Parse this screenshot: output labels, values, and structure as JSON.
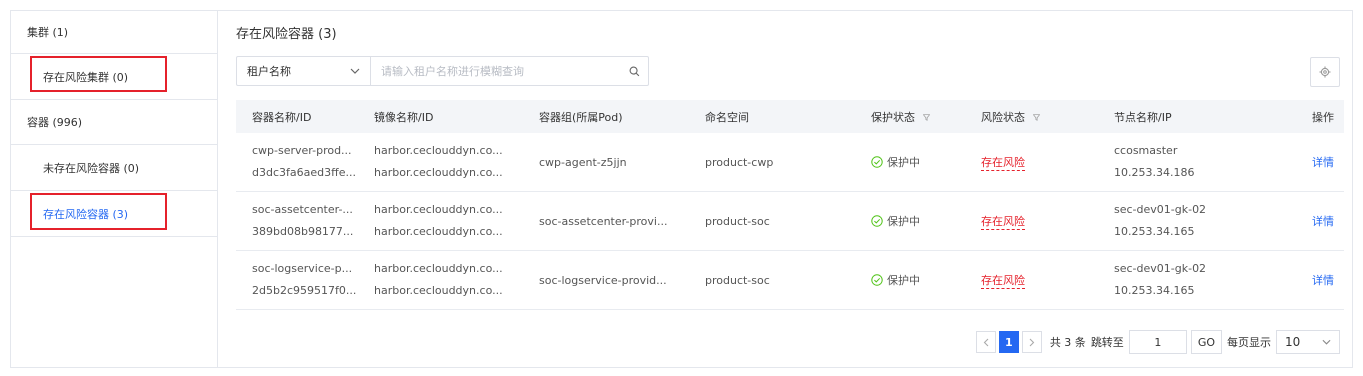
{
  "sidebar": {
    "items": [
      {
        "label": "集群 (1)"
      },
      {
        "label": "存在风险集群 (0)"
      },
      {
        "label": "容器 (996)"
      },
      {
        "label": "未存在风险容器 (0)"
      },
      {
        "label": "存在风险容器 (3)"
      }
    ]
  },
  "main": {
    "title": "存在风险容器 (3)",
    "search": {
      "select_value": "租户名称",
      "placeholder": "请输入租户名称进行模糊查询"
    }
  },
  "table": {
    "headers": [
      "容器名称/ID",
      "镜像名称/ID",
      "容器组(所属Pod)",
      "命名空间",
      "保护状态",
      "风险状态",
      "节点名称/IP",
      "操作"
    ],
    "rows": [
      {
        "name": "cwp-server-prod...",
        "id": "d3dc3fa6aed3ffe...",
        "image_name": "harbor.ceclouddyn.co...",
        "image_id": "harbor.ceclouddyn.co...",
        "pod": "cwp-agent-z5jjn",
        "namespace": "product-cwp",
        "protect": "保护中",
        "risk": "存在风险",
        "node": "ccosmaster",
        "ip": "10.253.34.186",
        "action": "详情"
      },
      {
        "name": "soc-assetcenter-...",
        "id": "389bd08b98177...",
        "image_name": "harbor.ceclouddyn.co...",
        "image_id": "harbor.ceclouddyn.co...",
        "pod": "soc-assetcenter-provi...",
        "namespace": "product-soc",
        "protect": "保护中",
        "risk": "存在风险",
        "node": "sec-dev01-gk-02",
        "ip": "10.253.34.165",
        "action": "详情"
      },
      {
        "name": "soc-logservice-p...",
        "id": "2d5b2c959517f0...",
        "image_name": "harbor.ceclouddyn.co...",
        "image_id": "harbor.ceclouddyn.co...",
        "pod": "soc-logservice-provid...",
        "namespace": "product-soc",
        "protect": "保护中",
        "risk": "存在风险",
        "node": "sec-dev01-gk-02",
        "ip": "10.253.34.165",
        "action": "详情"
      }
    ]
  },
  "pagination": {
    "current_page": "1",
    "total_text": "共 3 条",
    "jump_label": "跳转至",
    "jump_value": "1",
    "go_label": "GO",
    "page_size_label": "每页显示",
    "page_size": "10"
  },
  "colors": {
    "accent": "#2468f2",
    "risk": "#e5212b",
    "highlight_box": "#e5212b",
    "ok": "#52c41a"
  },
  "icons": [
    "chevron-down-icon",
    "search-icon",
    "gear-icon",
    "filter-icon",
    "check-circle-icon",
    "chevron-left-icon",
    "chevron-right-icon"
  ]
}
